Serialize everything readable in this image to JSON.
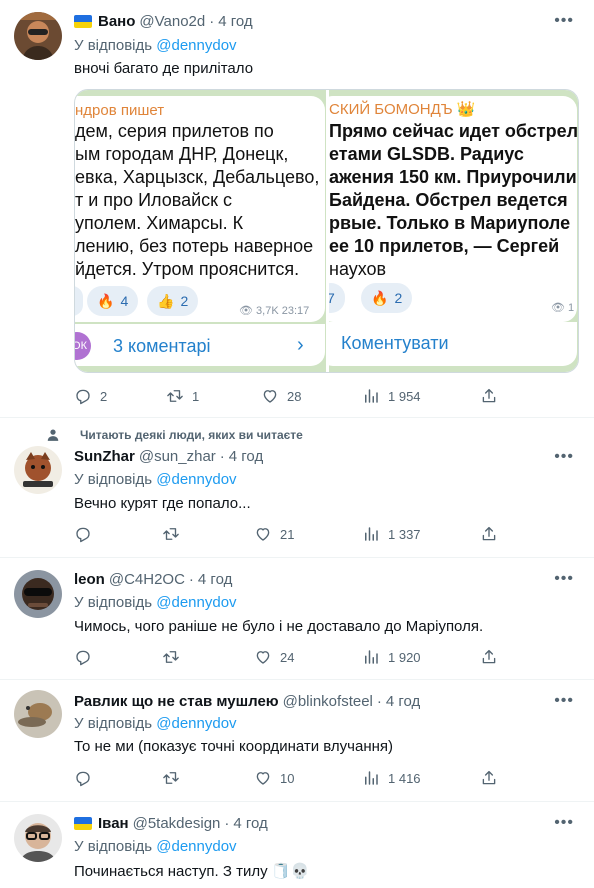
{
  "colors": {
    "accent": "#1d9bf0",
    "muted": "#536471",
    "text": "#0f1419"
  },
  "tweets": [
    {
      "name": "Вано",
      "handle": "@Vano2d",
      "time": "4 год",
      "reply_prefix": "У відповідь",
      "reply_to": "@dennydov",
      "text": "вночі багато де прилітало",
      "replies": "2",
      "retweets": "1",
      "likes": "28",
      "views": "1 954",
      "media": {
        "left": {
          "channel": "ндров пишет",
          "lines": [
            "дем, серия прилетов по",
            "ым городам ДНР, Донецк,",
            "евка, Харцызск, Дебальцево,",
            "т и про Иловайск с",
            "уполем. Химарсы. К",
            "лению, без потерь наверное",
            "йдется. Утром прояснится."
          ],
          "reactions": [
            {
              "icon": "fire",
              "count": "4"
            },
            {
              "icon": "thumbs-up",
              "count": "2"
            }
          ],
          "views": "3,7K",
          "time": "23:17",
          "comments_icon_label": "ОК",
          "comments_label": "3 коментарі"
        },
        "right": {
          "channel": "СКИЙ БОМОНДЪ",
          "lines": [
            "Прямо сейчас идет обстрел Д",
            "етами GLSDB. Радиус",
            "ажения 150 км. Приурочили",
            "Байдена. Обстрел ведется",
            "рвые. Только в Мариуполе",
            "ее 10 прилетов, — Сергей"
          ],
          "last_line": "наухов",
          "reactions": [
            {
              "icon": "",
              "count": "7"
            },
            {
              "icon": "fire",
              "count": "2"
            }
          ],
          "views": "1",
          "comment_label": "Коментувати"
        }
      }
    },
    {
      "social_context": "Читають деякі люди, яких ви читаєте",
      "name": "SunZhar",
      "handle": "@sun_zhar",
      "time": "4 год",
      "reply_prefix": "У відповідь",
      "reply_to": "@dennydov",
      "text": "Вечно курят где попало...",
      "replies": "",
      "retweets": "",
      "likes": "21",
      "views": "1 337"
    },
    {
      "name": "leon",
      "handle": "@C4H2OC",
      "time": "4 год",
      "reply_prefix": "У відповідь",
      "reply_to": "@dennydov",
      "text": "Чимось, чого раніше не було і не доставало до Маріуполя.",
      "replies": "",
      "retweets": "",
      "likes": "24",
      "views": "1 920"
    },
    {
      "name": "Равлик що не став мушлею",
      "handle": "@blinkofsteel",
      "time": "4 год",
      "reply_prefix": "У відповідь",
      "reply_to": "@dennydov",
      "text": "То не ми (показує точні координати влучання)",
      "replies": "",
      "retweets": "",
      "likes": "10",
      "views": "1 416"
    },
    {
      "name": "Іван",
      "handle": "@5takdesign",
      "time": "4 год",
      "reply_prefix": "У відповідь",
      "reply_to": "@dennydov",
      "text": "Починається наступ. З тилу"
    }
  ]
}
